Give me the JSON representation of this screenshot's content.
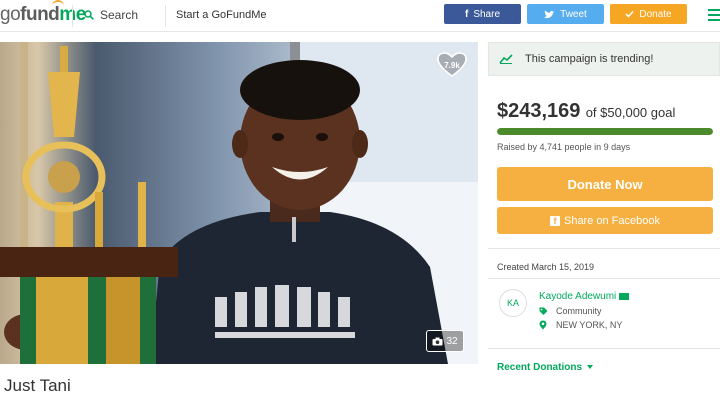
{
  "header": {
    "logo_go": "go",
    "logo_fund": "fund",
    "logo_me": "me",
    "search_label": "Search",
    "start_label": "Start a GoFundMe",
    "share_label": "Share",
    "tweet_label": "Tweet",
    "donate_label": "Donate",
    "icons": [
      "search-icon",
      "facebook-icon",
      "twitter-icon",
      "check-icon",
      "hamburger-icon"
    ]
  },
  "hero": {
    "favorites_count": "7.9k",
    "photo_count": "32"
  },
  "campaign": {
    "title": "Just Tani"
  },
  "sidebar": {
    "trending_text": "This campaign is trending!",
    "amount_raised": "$243,169",
    "goal_text": "of $50,000 goal",
    "progress_fraction": 1.0,
    "raised_by": "Raised by 4,741 people in 9 days",
    "donate_now_label": "Donate Now",
    "share_facebook_label": "Share on Facebook",
    "created": "Created March 15, 2019",
    "organizer_initials": "KA",
    "organizer_name": "Kayode Adewumi",
    "category": "Community",
    "location": "NEW YORK, NY",
    "recent_donations_label": "Recent Donations"
  },
  "colors": {
    "brand_green": "#02a95c",
    "facebook": "#3b5998",
    "twitter": "#55acee",
    "donate_orange": "#f5a623",
    "progress_green": "#4c8b2b"
  }
}
